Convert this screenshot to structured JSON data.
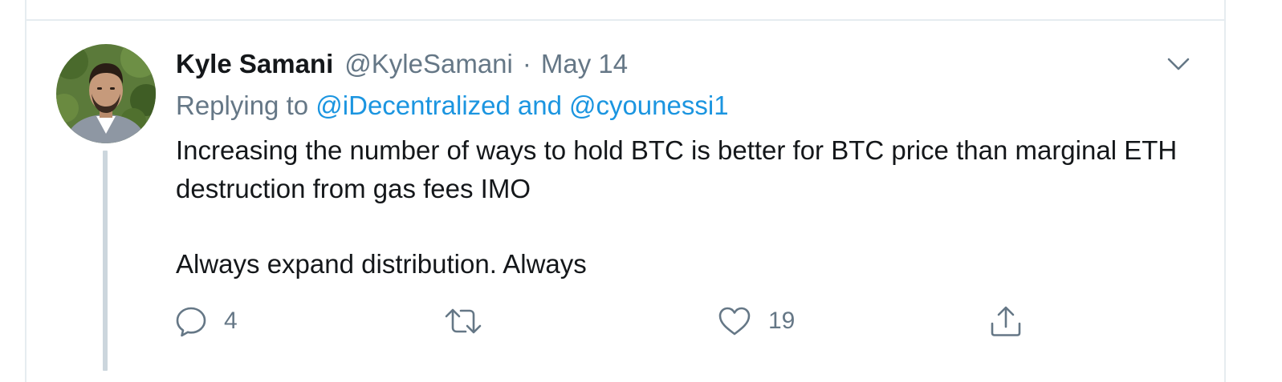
{
  "tweet": {
    "author": {
      "name": "Kyle Samani",
      "handle": "@KyleSamani"
    },
    "separator": "·",
    "timestamp": "May 14",
    "replying": {
      "label": "Replying to",
      "mentions": [
        "@iDecentralized",
        "@cyounessi1"
      ],
      "conjunction": "and"
    },
    "body": [
      "Increasing the number of ways to hold BTC is better for BTC price than marginal ETH destruction from gas fees IMO",
      "Always expand distribution. Always"
    ],
    "actions": {
      "reply": {
        "icon": "reply-icon",
        "count": "4"
      },
      "retweet": {
        "icon": "retweet-icon"
      },
      "like": {
        "icon": "heart-icon",
        "count": "19"
      },
      "share": {
        "icon": "share-icon"
      }
    }
  },
  "colors": {
    "text_primary": "#14171a",
    "text_secondary": "#657786",
    "link": "#1b95e0",
    "border": "#e6ecf0",
    "thread_line": "#ccd6dd"
  }
}
